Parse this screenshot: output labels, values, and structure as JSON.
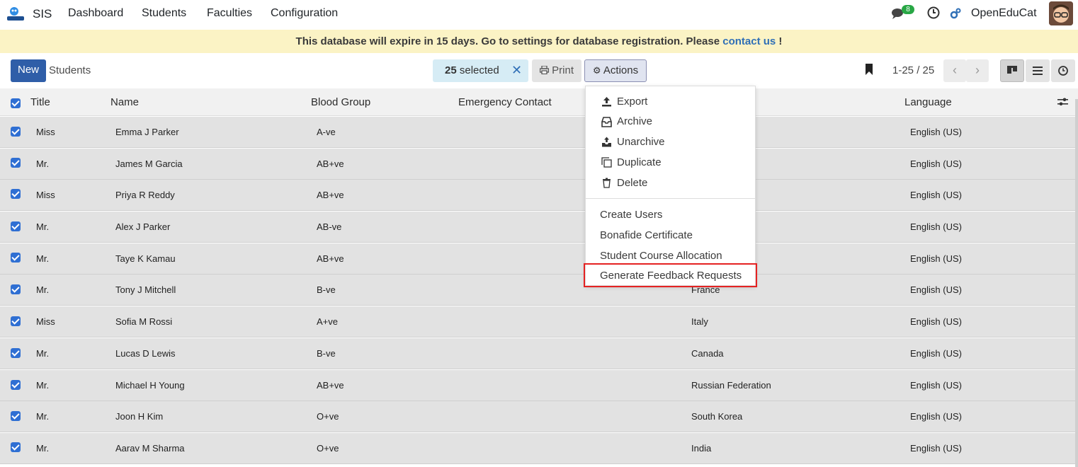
{
  "app": {
    "name": "SIS",
    "nav": [
      "Dashboard",
      "Students",
      "Faculties",
      "Configuration"
    ],
    "user": "OpenEduCat",
    "chat_count": "8"
  },
  "banner": {
    "text": "This database will expire in 15 days. Go to settings for database registration. Please ",
    "link": "contact us",
    "suffix": " !"
  },
  "control": {
    "new_label": "New",
    "breadcrumb": "Students",
    "selected_count": "25",
    "selected_label": " selected",
    "clear_icon": "close-icon",
    "print_label": "Print",
    "actions_label": "Actions",
    "pager": "1-25 / 25"
  },
  "columns": [
    "Title",
    "Name",
    "Blood Group",
    "Emergency Contact",
    "Language"
  ],
  "rows": [
    {
      "title": "Miss",
      "name": "Emma J Parker",
      "blood": "A-ve",
      "country": "",
      "language": "English (US)"
    },
    {
      "title": "Mr.",
      "name": "James M Garcia",
      "blood": "AB+ve",
      "country": "",
      "language": "English (US)"
    },
    {
      "title": "Miss",
      "name": "Priya R Reddy",
      "blood": "AB+ve",
      "country": "",
      "language": "English (US)"
    },
    {
      "title": "Mr.",
      "name": "Alex J Parker",
      "blood": "AB-ve",
      "country": "",
      "language": "English (US)"
    },
    {
      "title": "Mr.",
      "name": "Taye K Kamau",
      "blood": "AB+ve",
      "country": "",
      "language": "English (US)"
    },
    {
      "title": "Mr.",
      "name": "Tony J Mitchell",
      "blood": "B-ve",
      "country": "France",
      "language": "English (US)"
    },
    {
      "title": "Miss",
      "name": "Sofia M Rossi",
      "blood": "A+ve",
      "country": "Italy",
      "language": "English (US)"
    },
    {
      "title": "Mr.",
      "name": "Lucas D Lewis",
      "blood": "B-ve",
      "country": "Canada",
      "language": "English (US)"
    },
    {
      "title": "Mr.",
      "name": "Michael H Young",
      "blood": "AB+ve",
      "country": "Russian Federation",
      "language": "English (US)"
    },
    {
      "title": "Mr.",
      "name": "Joon H Kim",
      "blood": "O+ve",
      "country": "South Korea",
      "language": "English (US)"
    },
    {
      "title": "Mr.",
      "name": "Aarav M Sharma",
      "blood": "O+ve",
      "country": "India",
      "language": "English (US)"
    }
  ],
  "actions_menu": {
    "group1": [
      {
        "label": "Export",
        "icon": "upload-icon"
      },
      {
        "label": "Archive",
        "icon": "archive-icon"
      },
      {
        "label": "Unarchive",
        "icon": "unarchive-icon"
      },
      {
        "label": "Duplicate",
        "icon": "copy-icon"
      },
      {
        "label": "Delete",
        "icon": "trash-icon"
      }
    ],
    "group2": [
      "Create Users",
      "Bonafide Certificate",
      "Student Course Allocation",
      "Generate Feedback Requests"
    ]
  },
  "colors": {
    "primary": "#2f5ea8",
    "checkbox": "#2f6fd3",
    "banner_bg": "#fbf3c5",
    "highlight": "#e52222",
    "badge": "#28a745"
  }
}
